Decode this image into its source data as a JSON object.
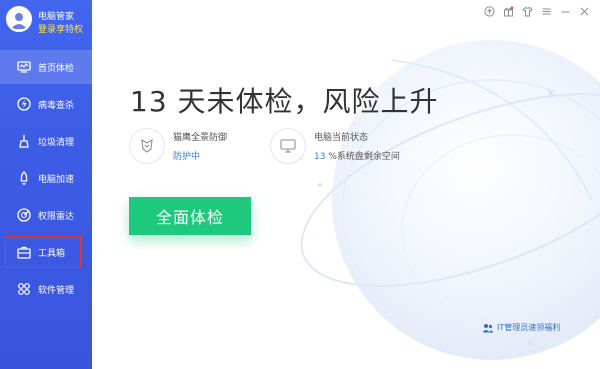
{
  "profile": {
    "name": "电脑管家",
    "link": "登录享特权"
  },
  "sidebar": {
    "items": [
      {
        "label": "首页体检",
        "icon": "monitor-icon"
      },
      {
        "label": "病毒查杀",
        "icon": "lightning-icon"
      },
      {
        "label": "垃圾清理",
        "icon": "broom-icon"
      },
      {
        "label": "电脑加速",
        "icon": "rocket-icon"
      },
      {
        "label": "权限雷达",
        "icon": "radar-icon"
      },
      {
        "label": "工具箱",
        "icon": "toolbox-icon"
      },
      {
        "label": "软件管理",
        "icon": "apps-icon"
      }
    ],
    "active_index": 0,
    "highlighted_index": 5
  },
  "window_controls": [
    "upload-icon",
    "gift-icon",
    "shirt-icon",
    "menu-icon",
    "minimize-icon",
    "close-icon"
  ],
  "main": {
    "headline": "13 天未体检，风险上升",
    "protection": {
      "title": "猫鹰全景防御",
      "status": "防护中"
    },
    "pc_state": {
      "title": "电脑当前状态",
      "percent": "13",
      "suffix": "%系统盘剩余空间"
    },
    "scan_button": "全面体检",
    "promo": "IT管理员速领福利"
  },
  "colors": {
    "sidebar": "#3d5ce6",
    "accent_green": "#1ec97e",
    "link_blue": "#2f7de9",
    "profile_link": "#ffe34d",
    "highlight_box": "#e03a3a"
  }
}
